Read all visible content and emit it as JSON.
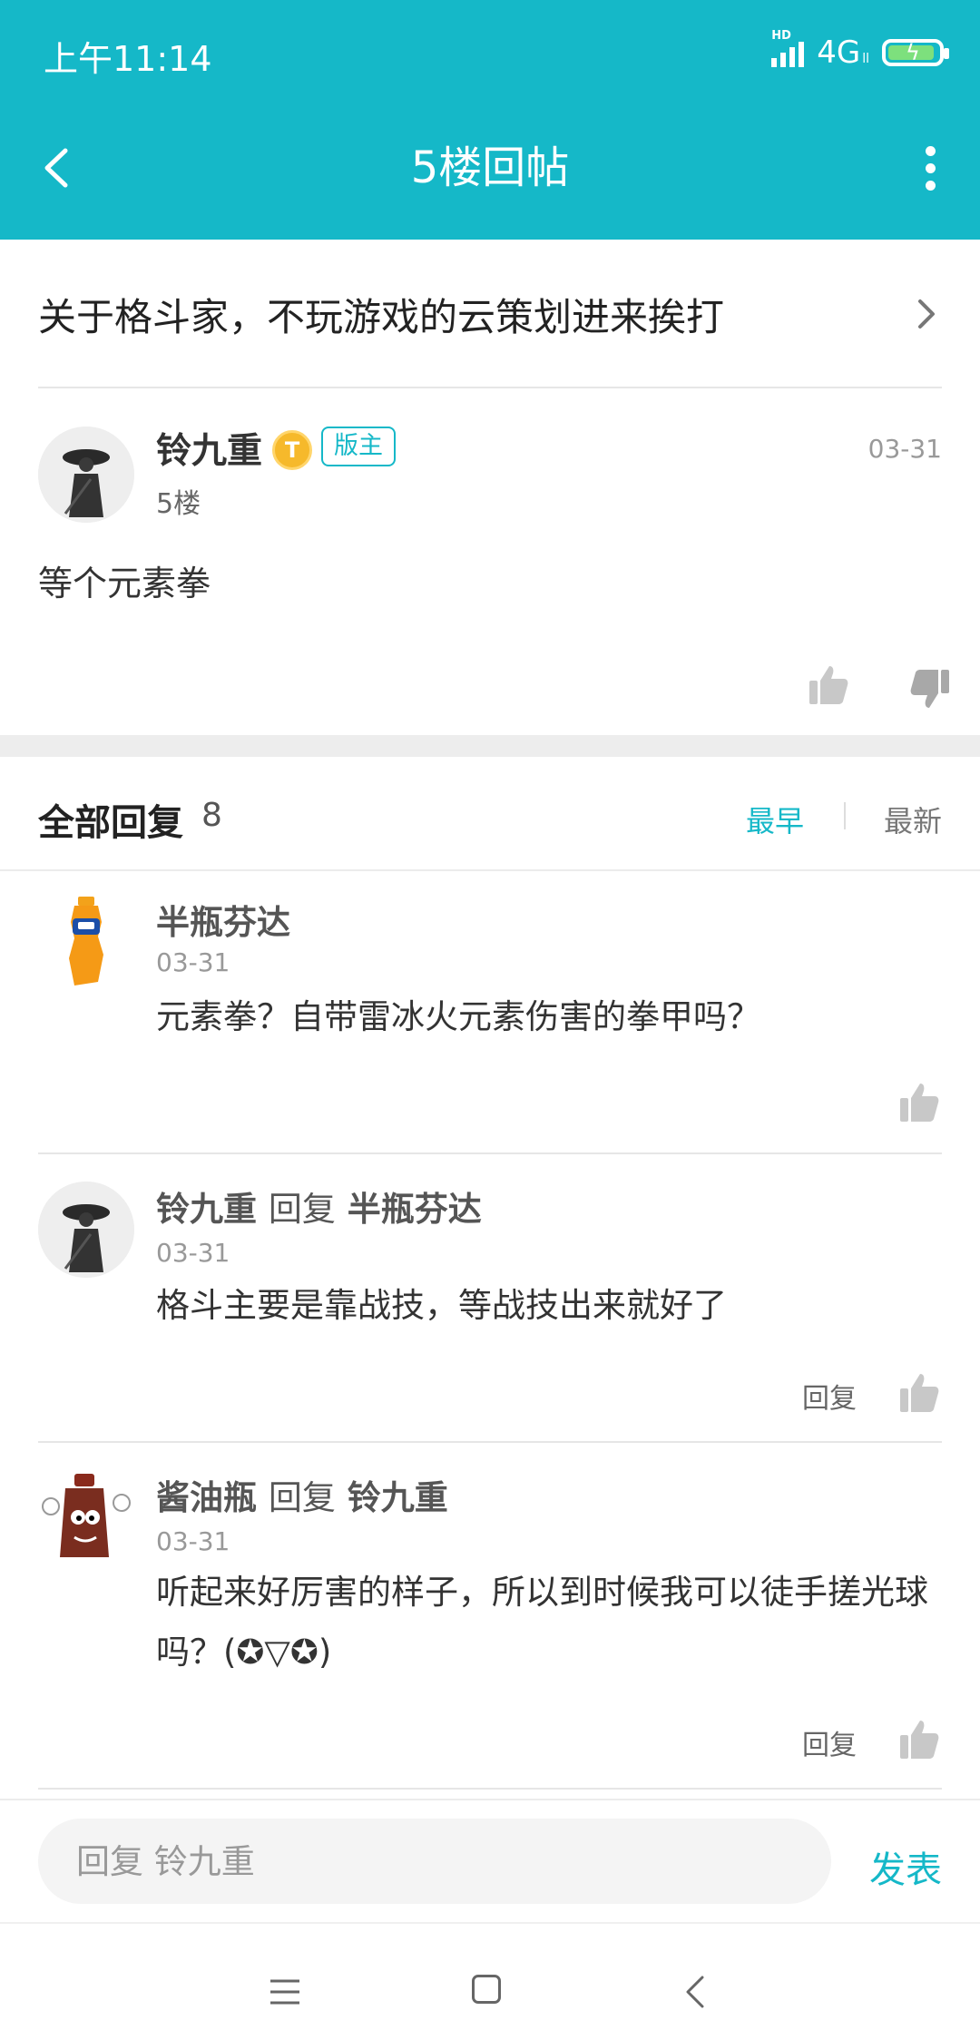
{
  "status_bar": {
    "time": "上午11:14",
    "hd": "HD",
    "network": "4G",
    "net_sub": "ll"
  },
  "header": {
    "title": "5楼回帖"
  },
  "thread": {
    "title": "关于格斗家，不玩游戏的云策划进来挨打"
  },
  "floor_post": {
    "author": "铃九重",
    "level_badge": "T",
    "role_badge": "版主",
    "date": "03-31",
    "floor": "5楼",
    "content": "等个元素拳"
  },
  "replies_header": {
    "title": "全部回复",
    "count": "8",
    "sort_options": [
      "最早",
      "最新"
    ],
    "active_sort": "最早"
  },
  "replies": [
    {
      "author": "半瓶芬达",
      "date": "03-31",
      "text": "元素拳？自带雷冰火元素伤害的拳甲吗？"
    },
    {
      "author": "铃九重",
      "reply_verb": "回复",
      "reply_to": "半瓶芬达",
      "date": "03-31",
      "text": "格斗主要是靠战技，等战技出来就好了",
      "action": "回复"
    },
    {
      "author": "酱油瓶",
      "reply_verb": "回复",
      "reply_to": "铃九重",
      "date": "03-31",
      "text": "听起来好厉害的样子，所以到时候我可以徒手搓光球吗？(✪▽✪)",
      "action": "回复"
    }
  ],
  "composer": {
    "placeholder": "回复 铃九重",
    "send_label": "发表"
  },
  "colors": {
    "accent": "#15b8c8",
    "page_bg": "#ffffff",
    "divider": "#e6e6e6"
  },
  "icons": [
    "back-arrow-icon",
    "more-vertical-icon",
    "chevron-right-icon",
    "thumbs-up-icon",
    "thumbs-down-icon",
    "menu-icon",
    "home-icon",
    "nav-back-icon"
  ]
}
